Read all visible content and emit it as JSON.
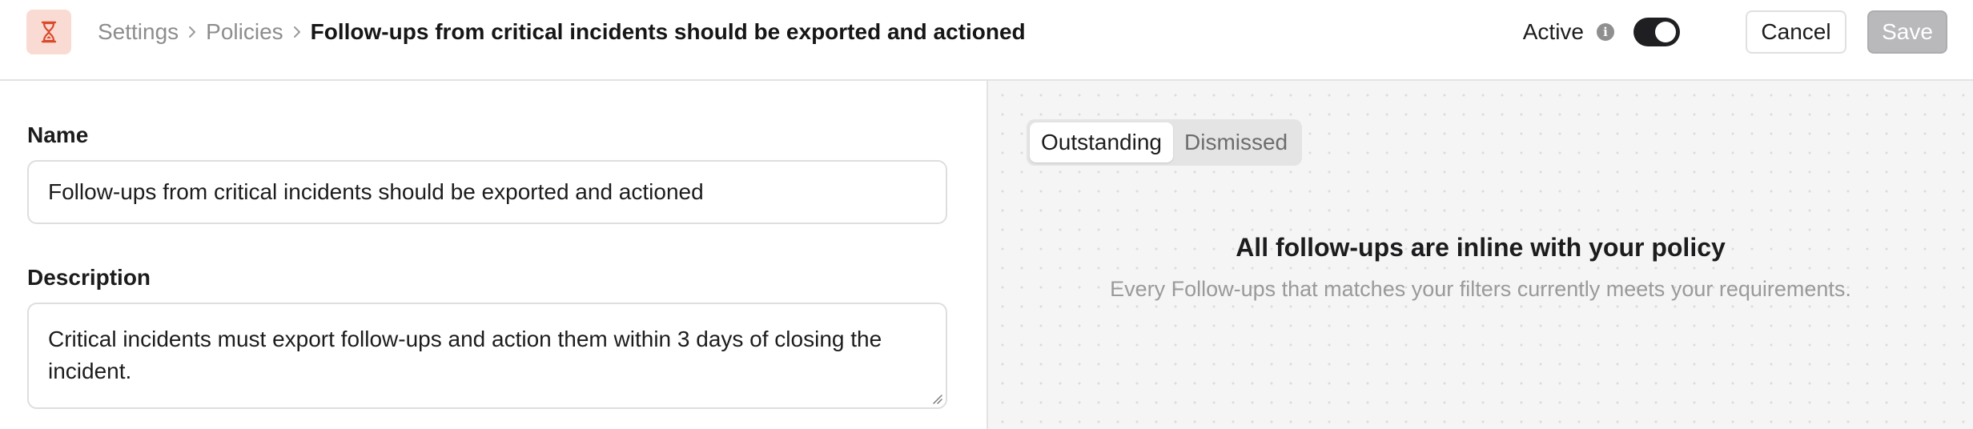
{
  "header": {
    "icon": "hourglass-icon",
    "icon_bg": "#fadbd3",
    "icon_color": "#d9492b",
    "breadcrumb": {
      "items": [
        "Settings",
        "Policies"
      ],
      "current": "Follow-ups from critical incidents should be exported and actioned"
    },
    "active_label": "Active",
    "active_enabled": true,
    "cancel_label": "Cancel",
    "save_label": "Save"
  },
  "form": {
    "name_label": "Name",
    "name_value": "Follow-ups from critical incidents should be exported and actioned",
    "description_label": "Description",
    "description_value": "Critical incidents must export follow-ups and action them within 3 days of closing the incident."
  },
  "preview": {
    "tabs": [
      {
        "label": "Outstanding",
        "active": true
      },
      {
        "label": "Dismissed",
        "active": false
      }
    ],
    "empty_title": "All follow-ups are inline with your policy",
    "empty_subtitle": "Every Follow-ups that matches your filters currently meets your requirements."
  }
}
